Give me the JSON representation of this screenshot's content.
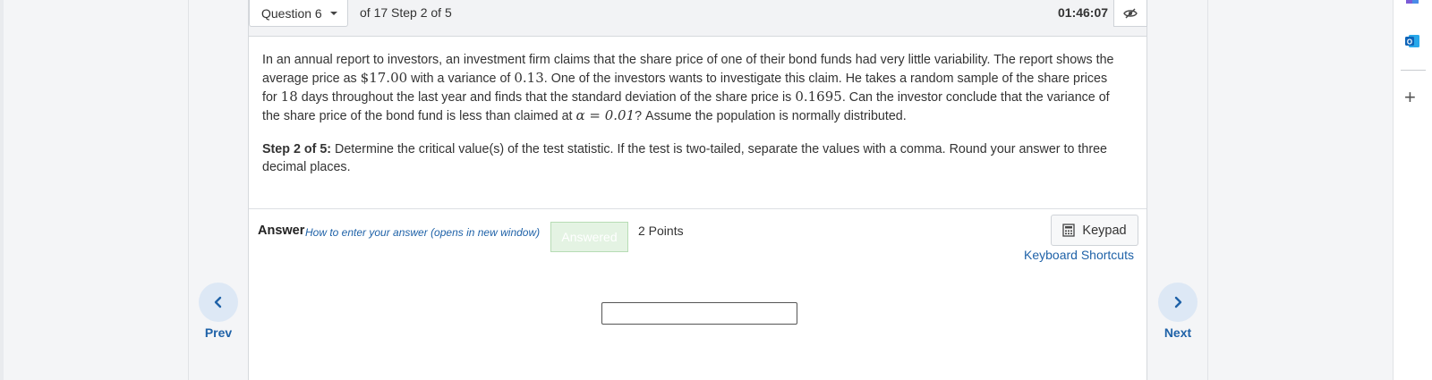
{
  "header": {
    "question_label": "Question 6",
    "progress_text": "of 17 Step 2 of 5",
    "timer": "01:46:07"
  },
  "question": {
    "part1": "In an annual report to investors, an investment firm claims that the share price of one of their bond funds had very little variability. The report shows the average price as ",
    "mean": "$17.00",
    "part2": " with a variance of ",
    "variance": "0.13",
    "part3": ". One of the investors wants to investigate this claim. He takes a random sample of the share prices for ",
    "n": "18",
    "part4": " days throughout the last year and finds that the standard deviation of the share price is ",
    "sd": "0.1695",
    "part5": ". Can the investor conclude that the variance of the share price of the bond fund is less than claimed at ",
    "alpha": "α = 0.01",
    "part6": "? Assume the population is normally distributed."
  },
  "step": {
    "label": "Step 2 of 5:",
    "text": " Determine the critical value(s) of the test statistic. If the test is two-tailed, separate the values with a comma. Round your answer to three decimal places."
  },
  "answer": {
    "label": "Answer",
    "howto_link": "How to enter your answer (opens in new window)",
    "status": "Answered",
    "points": "2 Points",
    "keypad_label": "Keypad",
    "shortcuts_label": "Keyboard Shortcuts",
    "input_value": ""
  },
  "nav": {
    "prev_label": "Prev",
    "next_label": "Next"
  },
  "icons": {
    "dropdown": "chevron-down-icon",
    "eye": "eye-slash-icon",
    "keypad": "calculator-icon",
    "prev": "chevron-left-icon",
    "next": "chevron-right-icon",
    "rail_add": "plus-icon",
    "rail_outlook": "outlook-icon",
    "rail_copilot": "copilot-icon"
  },
  "colors": {
    "link": "#1f62a8",
    "nav_circle": "#dde8f5",
    "answered_bg": "#e4f3e3",
    "answered_border": "#b7dcb5"
  }
}
